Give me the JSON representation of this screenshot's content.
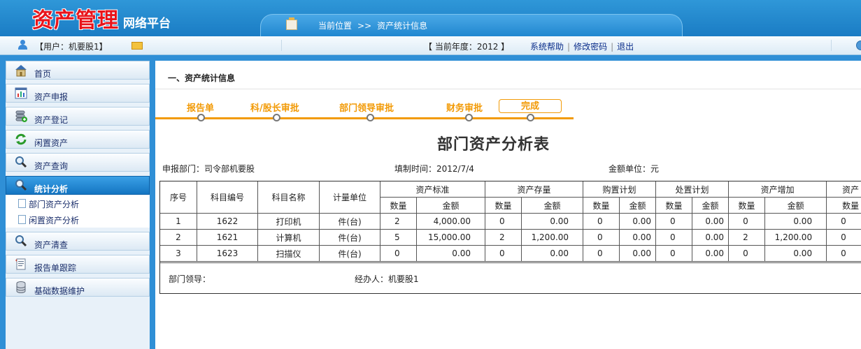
{
  "header": {
    "logo_main": "资产管理",
    "logo_sub": "网络平台",
    "breadcrumb_label": "当前位置",
    "breadcrumb_sep": ">>",
    "breadcrumb_current": "资产统计信息"
  },
  "infobar": {
    "user": "【用户：机要股1】",
    "year": "【 当前年度：2012 】",
    "links": [
      "系统帮助",
      "修改密码",
      "退出"
    ],
    "link_sep": "|"
  },
  "sidebar": {
    "items": [
      {
        "label": "首页",
        "icon": "home-icon"
      },
      {
        "label": "资产申报",
        "icon": "chart-icon"
      },
      {
        "label": "资产登记",
        "icon": "database-add-icon"
      },
      {
        "label": "闲置资产",
        "icon": "recycle-icon"
      },
      {
        "label": "资产查询",
        "icon": "search-icon"
      },
      {
        "label": "统计分析",
        "icon": "search-icon"
      },
      {
        "label": "资产清查",
        "icon": "search-icon"
      },
      {
        "label": "报告单跟踪",
        "icon": "report-icon"
      },
      {
        "label": "基础数据维护",
        "icon": "database-icon"
      }
    ],
    "sub_items": [
      "部门资产分析",
      "闲置资产分析"
    ]
  },
  "content": {
    "title": "一、资产统计信息",
    "steps": [
      "报告单",
      "科/股长审批",
      "部门领导审批",
      "财务审批",
      "完成"
    ],
    "report_title": "部门资产分析表",
    "meta": {
      "dept": "申报部门：司令部机要股",
      "time": "填制时间：2012/7/4",
      "unit": "金额单位：元"
    },
    "table": {
      "headers_fixed": [
        "序号",
        "科目编号",
        "科目名称",
        "计量单位"
      ],
      "groups": [
        "资产标准",
        "资产存量",
        "购置计划",
        "处置计划",
        "资产增加",
        "资产"
      ],
      "sub_qty": "数量",
      "sub_amt": "金额",
      "rows": [
        [
          "1",
          "1622",
          "打印机",
          "件(台)",
          "2",
          "4,000.00",
          "0",
          "0.00",
          "0",
          "0.00",
          "0",
          "0.00",
          "0",
          "0.00",
          "0"
        ],
        [
          "2",
          "1621",
          "计算机",
          "件(台)",
          "5",
          "15,000.00",
          "2",
          "1,200.00",
          "0",
          "0.00",
          "0",
          "0.00",
          "2",
          "1,200.00",
          "0"
        ],
        [
          "3",
          "1623",
          "扫描仪",
          "件(台)",
          "0",
          "0.00",
          "0",
          "0.00",
          "0",
          "0.00",
          "0",
          "0.00",
          "0",
          "0.00",
          "0"
        ]
      ],
      "footer_leader": "部门领导：",
      "footer_handler": "经办人：机要股1"
    }
  },
  "colors": {
    "brand_blue": "#2f8fd6",
    "step_orange": "#f29a06",
    "logo_red": "#e8141b"
  }
}
